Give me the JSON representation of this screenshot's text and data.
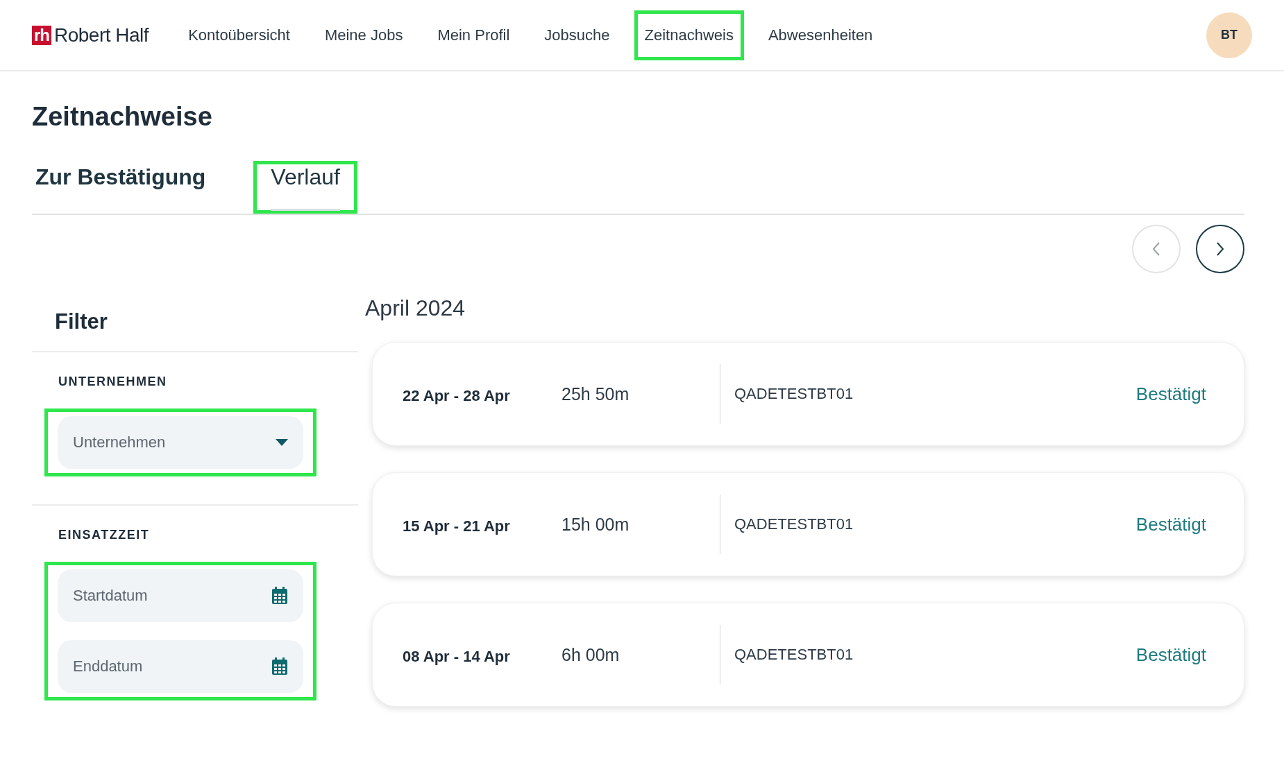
{
  "header": {
    "logo": {
      "mark": "rh",
      "name": "Robert Half"
    },
    "nav": [
      {
        "label": "Kontoübersicht",
        "highlighted": false
      },
      {
        "label": "Meine Jobs",
        "highlighted": false
      },
      {
        "label": "Mein Profil",
        "highlighted": false
      },
      {
        "label": "Jobsuche",
        "highlighted": false
      },
      {
        "label": "Zeitnachweis",
        "highlighted": true
      },
      {
        "label": "Abwesenheiten",
        "highlighted": false
      }
    ],
    "avatar": "BT"
  },
  "page_title": "Zeitnachweise",
  "tabs": [
    {
      "label": "Zur Bestätigung",
      "selected": false,
      "highlighted": false
    },
    {
      "label": "Verlauf",
      "selected": true,
      "highlighted": true
    }
  ],
  "pager": {
    "previous": {
      "disabled": true
    },
    "next": {
      "disabled": false
    }
  },
  "filter": {
    "title": "Filter",
    "sections": [
      {
        "kind": "dropdown",
        "heading": "UNTERNEHMEN",
        "highlighted": true,
        "fields": [
          {
            "placeholder": "Unternehmen"
          }
        ]
      },
      {
        "kind": "dates",
        "heading": "EINSATZZEIT",
        "highlighted": true,
        "fields": [
          {
            "placeholder": "Startdatum"
          },
          {
            "placeholder": "Enddatum"
          }
        ]
      }
    ]
  },
  "month": "April 2024",
  "timesheets": [
    {
      "period": "22 Apr - 28 Apr",
      "hours": "25h 50m",
      "client": "QADETESTBT01",
      "status": "Bestätigt"
    },
    {
      "period": "15 Apr - 21 Apr",
      "hours": "15h 00m",
      "client": "QADETESTBT01",
      "status": "Bestätigt"
    },
    {
      "period": "08 Apr - 14 Apr",
      "hours": "6h 00m",
      "client": "QADETESTBT01",
      "status": "Bestätigt"
    }
  ]
}
